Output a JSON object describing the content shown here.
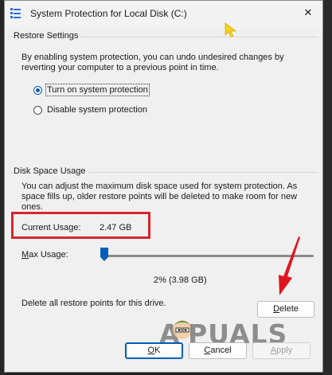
{
  "window": {
    "title": "System Protection for Local Disk (C:)",
    "close_glyph": "✕"
  },
  "restore_settings": {
    "heading": "Restore Settings",
    "description_line1": "By enabling system protection, you can undo undesired changes by",
    "description_line2": "reverting your computer to a previous point in time.",
    "options": [
      {
        "label": "Turn on system protection",
        "selected": true
      },
      {
        "label": "Disable system protection",
        "selected": false
      }
    ]
  },
  "disk_space": {
    "heading": "Disk Space Usage",
    "description_line1": "You can adjust the maximum disk space used for system protection. As",
    "description_line2": "space fills up, older restore points will be deleted to make room for new",
    "description_line3": "ones.",
    "current_usage_label": "Current Usage:",
    "current_usage_value": "2.47 GB",
    "max_usage_label": "Max Usage:",
    "max_usage_percent": 2,
    "max_usage_display": "2% (3.98 GB)",
    "delete_text": "Delete all restore points for this drive.",
    "delete_button": "Delete"
  },
  "buttons": {
    "ok": "OK",
    "cancel": "Cancel",
    "apply": "Apply"
  },
  "watermark": {
    "text": "PUALS",
    "letter": "A"
  },
  "colors": {
    "accent": "#005fb8",
    "highlight_box": "#d7262d",
    "arrow": "#e0161e"
  }
}
